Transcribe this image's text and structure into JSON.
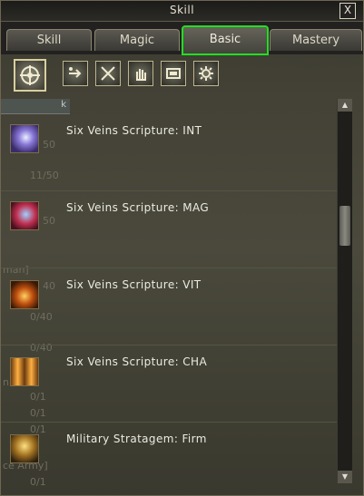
{
  "window": {
    "title": "Skill",
    "close_label": "X"
  },
  "tabs": [
    {
      "label": "Skill",
      "active": false
    },
    {
      "label": "Magic",
      "active": false
    },
    {
      "label": "Basic",
      "active": true
    },
    {
      "label": "Mastery",
      "active": false
    }
  ],
  "category_icons": [
    "compass-icon",
    "arrow-move-icon",
    "crossed-swords-icon",
    "hand-icon",
    "frame-icon",
    "gear-icon"
  ],
  "list_header": {
    "label": "k"
  },
  "skills": [
    {
      "name": "Six Veins Scripture: INT",
      "icon": "int-scripture-icon"
    },
    {
      "name": "Six Veins Scripture: MAG",
      "icon": "mag-scripture-icon"
    },
    {
      "name": "Six Veins Scripture: VIT",
      "icon": "vit-scripture-icon"
    },
    {
      "name": "Six Veins Scripture: CHA",
      "icon": "cha-scripture-icon"
    },
    {
      "name": "Military Stratagem: Firm",
      "icon": "stratagem-firm-icon"
    }
  ],
  "background_text": [
    "50",
    "11/50",
    "50",
    "man]",
    "40",
    "0/40",
    "0/40",
    "n",
    "0/1",
    "0/1",
    "0/1",
    "ce Army]",
    "0/1"
  ],
  "colors": {
    "active_tab_border": "#20e020",
    "text": "#ecebe2",
    "panel": "#444236"
  }
}
